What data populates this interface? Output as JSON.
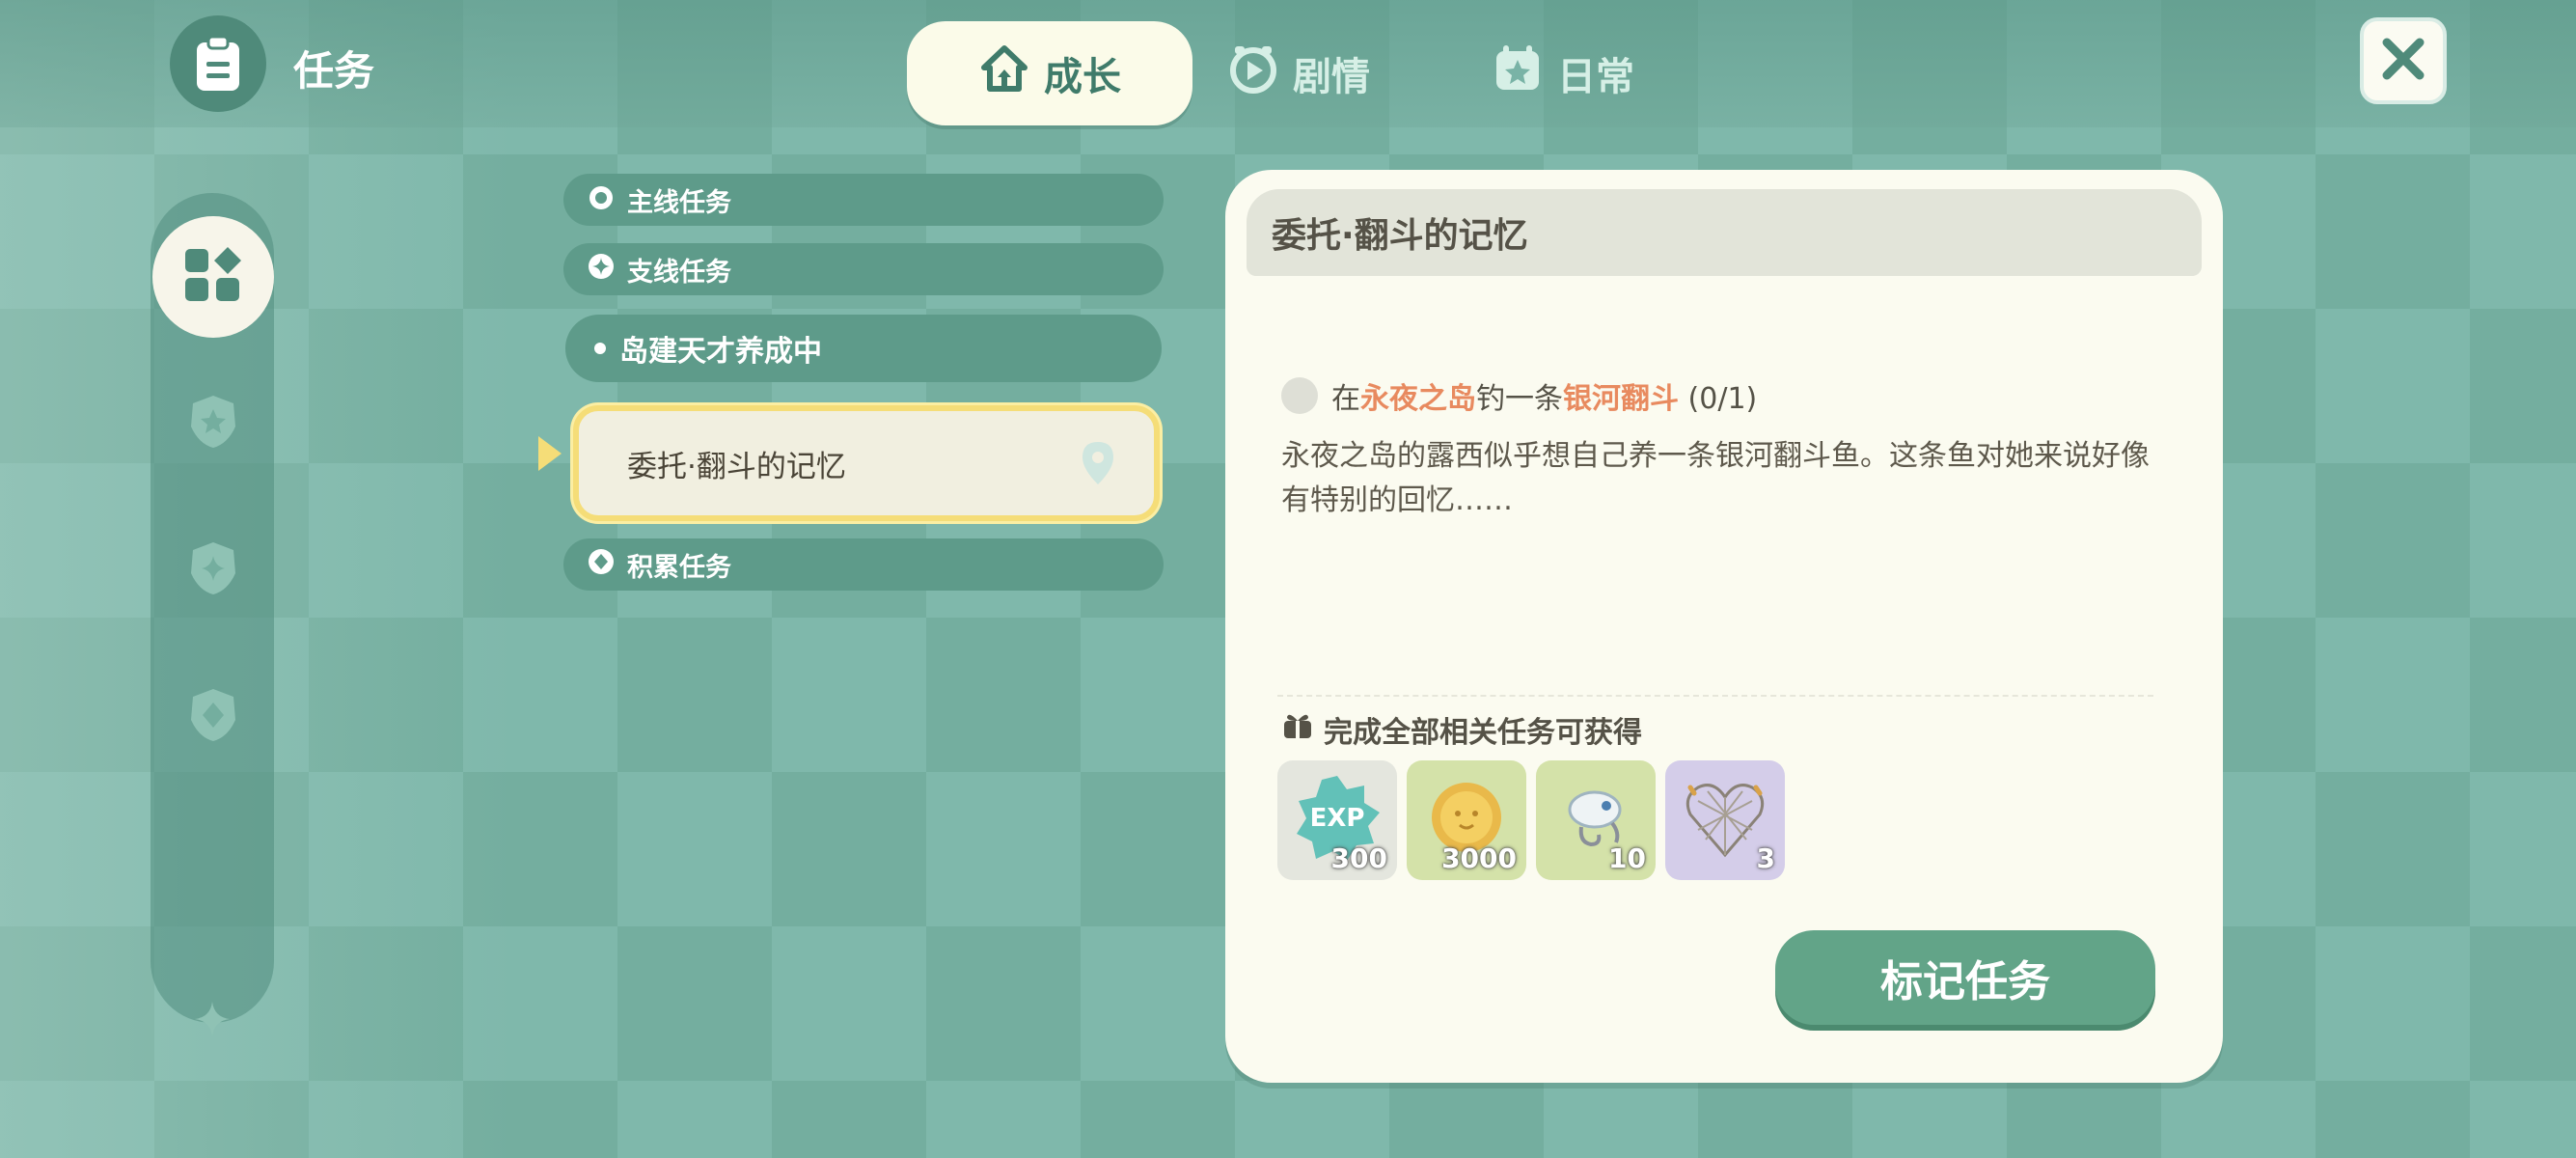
{
  "header": {
    "title": "任务",
    "tabs": [
      {
        "label": "成长",
        "active": true
      },
      {
        "label": "剧情",
        "active": false
      },
      {
        "label": "日常",
        "active": false
      }
    ]
  },
  "quest_list": {
    "categories": {
      "main": "主线任务",
      "side": "支线任务",
      "accumulate": "积累任务"
    },
    "sub_item": "岛建天才养成中",
    "selected_quest": "委托·翻斗的记忆"
  },
  "detail": {
    "title": "委托·翻斗的记忆",
    "objective": {
      "prefix": "在",
      "location": "永夜之岛",
      "middle": "钓一条",
      "target": "银河翻斗",
      "progress": "(0/1)"
    },
    "description": "永夜之岛的露西似乎想自己养一条银河翻斗鱼。这条鱼对她来说好像有特别的回忆……",
    "reward_title": "完成全部相关任务可获得",
    "rewards": [
      {
        "icon": "exp-icon",
        "label": "EXP",
        "qty": "300"
      },
      {
        "icon": "coin-icon",
        "qty": "3000"
      },
      {
        "icon": "fishing-lure-icon",
        "qty": "10"
      },
      {
        "icon": "heart-net-icon",
        "qty": "3"
      }
    ],
    "mark_button": "标记任务"
  },
  "colors": {
    "accent": "#62a488",
    "highlight": "#e88a5f",
    "selected_border": "#f5dd78",
    "panel_bg": "#fbfbf0"
  }
}
